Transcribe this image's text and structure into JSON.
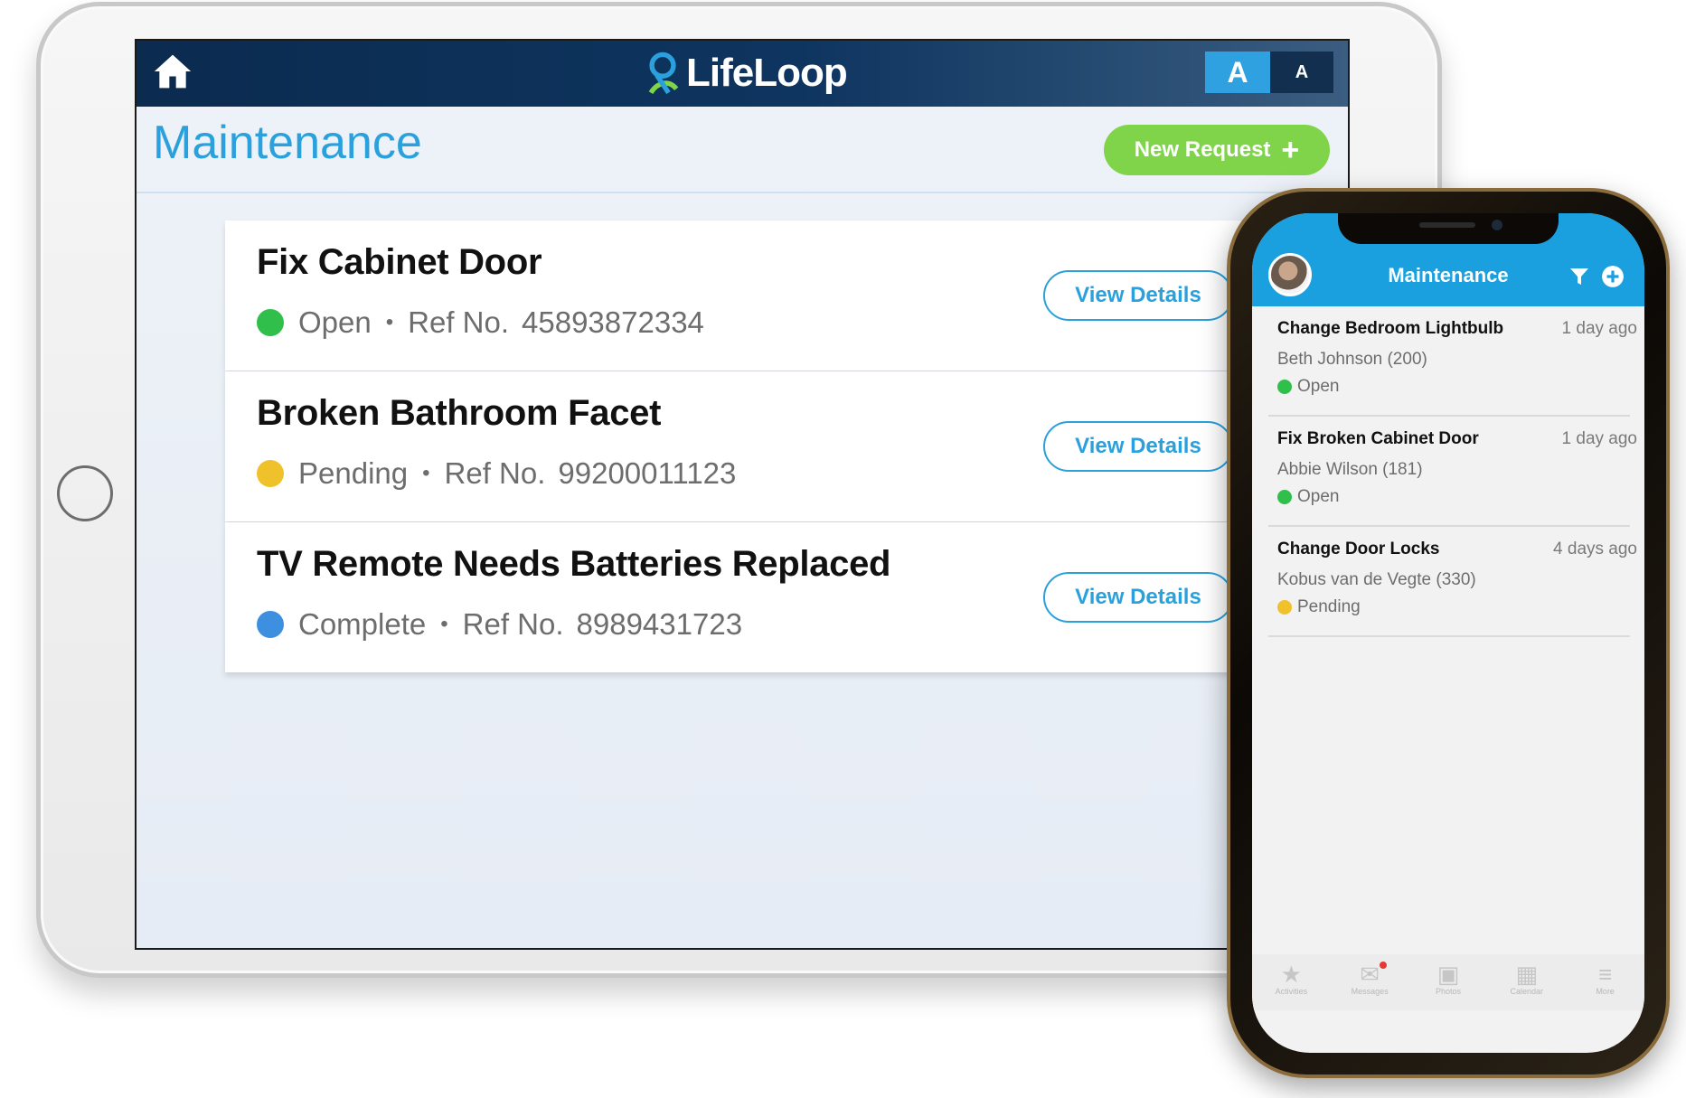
{
  "tablet": {
    "logo": "LifeLoop",
    "font_large": "A",
    "font_small": "A",
    "page_title": "Maintenance",
    "new_request": "New Request",
    "ref_label": "Ref No.",
    "view_details": "View Details",
    "requests": [
      {
        "title": "Fix Cabinet Door",
        "status": "Open",
        "status_color": "#2fbf4a",
        "ref": "45893872334"
      },
      {
        "title": "Broken Bathroom Facet",
        "status": "Pending",
        "status_color": "#efc12a",
        "ref": "99200011123"
      },
      {
        "title": "TV Remote Needs Batteries Replaced",
        "status": "Complete",
        "status_color": "#3d8fe0",
        "ref": "8989431723"
      }
    ]
  },
  "phone": {
    "title": "Maintenance",
    "items": [
      {
        "title": "Change Bedroom Lightbulb",
        "time": "1 day ago",
        "person": "Beth Johnson (200)",
        "status": "Open",
        "status_color": "#2fbf4a"
      },
      {
        "title": "Fix Broken Cabinet Door",
        "time": "1 day ago",
        "person": "Abbie Wilson (181)",
        "status": "Open",
        "status_color": "#2fbf4a"
      },
      {
        "title": "Change Door Locks",
        "time": "4 days ago",
        "person": "Kobus van de Vegte (330)",
        "status": "Pending",
        "status_color": "#efc12a"
      }
    ],
    "tabs": [
      {
        "label": "Activities",
        "icon": "star-icon"
      },
      {
        "label": "Messages",
        "icon": "envelope-icon"
      },
      {
        "label": "Photos",
        "icon": "photos-icon"
      },
      {
        "label": "Calendar",
        "icon": "calendar-icon"
      },
      {
        "label": "More",
        "icon": "menu-icon"
      }
    ]
  },
  "colors": {
    "accent_blue": "#2aa0dc",
    "new_request_green": "#7fd44a",
    "navbar_navy": "#0b2b4f"
  }
}
